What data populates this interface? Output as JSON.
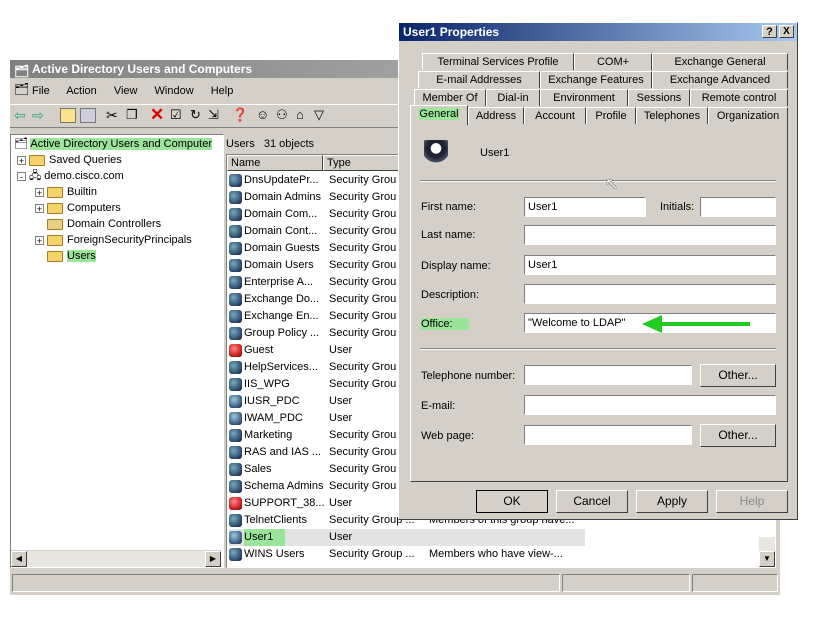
{
  "main_window": {
    "title": "Active Directory Users and Computers",
    "menu": [
      "File",
      "Action",
      "View",
      "Window",
      "Help"
    ],
    "tree": [
      {
        "label": "Active Directory Users and Computer"
      },
      {
        "label": "Saved Queries"
      },
      {
        "label": "demo.cisco.com"
      },
      {
        "label": "Builtin"
      },
      {
        "label": "Computers"
      },
      {
        "label": "Domain Controllers"
      },
      {
        "label": "ForeignSecurityPrincipals"
      },
      {
        "label": "Users"
      }
    ],
    "list_header": "Users   31 objects",
    "columns": [
      "Name",
      "Type"
    ],
    "rows": [
      {
        "name": "DnsUpdatePr...",
        "type": "Security Grou",
        "icon": "group-icon"
      },
      {
        "name": "Domain Admins",
        "type": "Security Grou",
        "icon": "group-icon"
      },
      {
        "name": "Domain Com...",
        "type": "Security Grou",
        "icon": "group-icon"
      },
      {
        "name": "Domain Cont...",
        "type": "Security Grou",
        "icon": "group-icon"
      },
      {
        "name": "Domain Guests",
        "type": "Security Grou",
        "icon": "group-icon"
      },
      {
        "name": "Domain Users",
        "type": "Security Grou",
        "icon": "group-icon"
      },
      {
        "name": "Enterprise A...",
        "type": "Security Grou",
        "icon": "group-icon"
      },
      {
        "name": "Exchange Do...",
        "type": "Security Grou",
        "icon": "group-icon"
      },
      {
        "name": "Exchange En...",
        "type": "Security Grou",
        "icon": "group-icon"
      },
      {
        "name": "Group Policy ...",
        "type": "Security Grou",
        "icon": "group-icon"
      },
      {
        "name": "Guest",
        "type": "User",
        "icon": "disabled-user-icon"
      },
      {
        "name": "HelpServices...",
        "type": "Security Grou",
        "icon": "group-icon"
      },
      {
        "name": "IIS_WPG",
        "type": "Security Grou",
        "icon": "group-icon"
      },
      {
        "name": "IUSR_PDC",
        "type": "User",
        "icon": "user-icon"
      },
      {
        "name": "IWAM_PDC",
        "type": "User",
        "icon": "user-icon"
      },
      {
        "name": "Marketing",
        "type": "Security Grou",
        "icon": "group-icon"
      },
      {
        "name": "RAS and IAS ...",
        "type": "Security Grou",
        "icon": "group-icon"
      },
      {
        "name": "Sales",
        "type": "Security Grou",
        "icon": "group-icon"
      },
      {
        "name": "Schema Admins",
        "type": "Security Grou",
        "icon": "group-icon"
      },
      {
        "name": "SUPPORT_38...",
        "type": "User",
        "icon": "disabled-user-icon"
      },
      {
        "name": "TelnetClients",
        "type": "Security Group ...",
        "icon": "group-icon",
        "desc": "Members of this group have..."
      },
      {
        "name": "User1",
        "type": "User",
        "icon": "user-icon"
      },
      {
        "name": "WINS Users",
        "type": "Security Group ...",
        "icon": "group-icon",
        "desc": "Members who have view-..."
      }
    ]
  },
  "dialog": {
    "title": "User1 Properties",
    "help_btn": "?",
    "close_btn": "X",
    "tabs_row1": [
      "Terminal Services Profile",
      "COM+",
      "Exchange General"
    ],
    "tabs_row2": [
      "E-mail Addresses",
      "Exchange Features",
      "Exchange Advanced"
    ],
    "tabs_row3": [
      "Member Of",
      "Dial-in",
      "Environment",
      "Sessions",
      "Remote control"
    ],
    "tabs_row4": [
      "General",
      "Address",
      "Account",
      "Profile",
      "Telephones",
      "Organization"
    ],
    "user_name": "User1",
    "fields": {
      "first_name_label": "First name:",
      "first_name": "User1",
      "initials_label": "Initials:",
      "initials": "",
      "last_name_label": "Last name:",
      "last_name": "",
      "display_name_label": "Display name:",
      "display_name": "User1",
      "description_label": "Description:",
      "description": "",
      "office_label": "Office:",
      "office": "\"Welcome to LDAP\"",
      "telephone_label": "Telephone number:",
      "telephone": "",
      "email_label": "E-mail:",
      "email": "",
      "webpage_label": "Web page:",
      "webpage": ""
    },
    "other_btn_1": "Other...",
    "other_btn_2": "Other...",
    "buttons": {
      "ok": "OK",
      "cancel": "Cancel",
      "apply": "Apply",
      "help": "Help"
    }
  },
  "colors": {
    "highlight": "#9be59b",
    "arrow": "#22cc22",
    "titlebar_active": "#0a246a"
  }
}
